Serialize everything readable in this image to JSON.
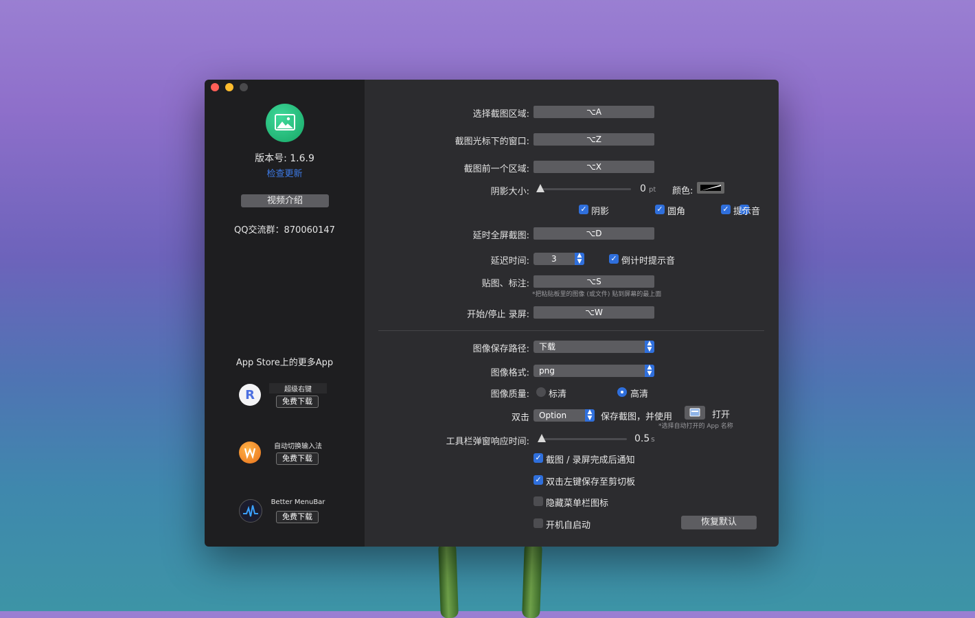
{
  "sidebar": {
    "version": "版本号: 1.6.9",
    "check_update": "检查更新",
    "video_intro": "视频介绍",
    "qq_group": "QQ交流群：870060147",
    "more_apps_title": "App Store上的更多App",
    "promos": [
      {
        "name": "超级右键",
        "button": "免费下载",
        "icon": "r-icon"
      },
      {
        "name": "自动切换输入法",
        "button": "免费下载",
        "icon": "input-method-icon"
      },
      {
        "name": "Better MenuBar",
        "button": "免费下载",
        "icon": "menubar-icon"
      }
    ]
  },
  "settings": {
    "select_area": {
      "label": "选择截图区域:",
      "shortcut": "⌥A"
    },
    "window_under_cursor": {
      "label": "截图光标下的窗口:",
      "shortcut": "⌥Z"
    },
    "previous_area": {
      "label": "截图前一个区域:",
      "shortcut": "⌥X"
    },
    "shadow_size": {
      "label": "阴影大小:",
      "value": "0",
      "unit": "pt",
      "level": 0,
      "color_label": "颜色:"
    },
    "toggles_row": [
      {
        "label": "阴影",
        "checked": true
      },
      {
        "label": "圆角",
        "checked": true
      },
      {
        "label": "提示音",
        "checked": true
      }
    ],
    "delay_fullscreen": {
      "label": "延时全屏截图:",
      "shortcut": "⌥D"
    },
    "delay_time": {
      "label": "延迟时间:",
      "value": "3",
      "countdown_label": "倒计时提示音",
      "countdown_checked": true
    },
    "paste_annotate": {
      "label": "贴图、标注:",
      "shortcut": "⌥S",
      "hint": "*把粘贴板里的图像 (或文件) 贴到屏幕的最上面"
    },
    "record": {
      "label": "开始/停止 录屏:",
      "shortcut": "⌥W"
    },
    "save_path": {
      "label": "图像保存路径:",
      "value": "下载"
    },
    "format": {
      "label": "图像格式:",
      "value": "png"
    },
    "quality": {
      "label": "图像质量:",
      "options": [
        {
          "label": "标清",
          "selected": false
        },
        {
          "label": "高清",
          "selected": true
        }
      ]
    },
    "double_click": {
      "prefix": "双击",
      "key": "Option",
      "middle": "保存截图，并使用",
      "action": "打开",
      "hint": "*选择自动打开的 App 名称"
    },
    "toolbar_delay": {
      "label": "工具栏弹窗响应时间:",
      "value": "0.5",
      "unit": "s",
      "level": 0
    },
    "checks": [
      {
        "label": "截图 / 录屏完成后通知",
        "checked": true
      },
      {
        "label": "双击左键保存至剪切板",
        "checked": true
      },
      {
        "label": "隐藏菜单栏图标",
        "checked": false
      },
      {
        "label": "开机自启动",
        "checked": false
      }
    ],
    "restore_default": "恢复默认"
  },
  "colors": {
    "accent": "#2f6fdc",
    "sidebar_bg": "#1e1e20",
    "main_bg": "#2c2c2f",
    "link": "#3d7be8"
  }
}
